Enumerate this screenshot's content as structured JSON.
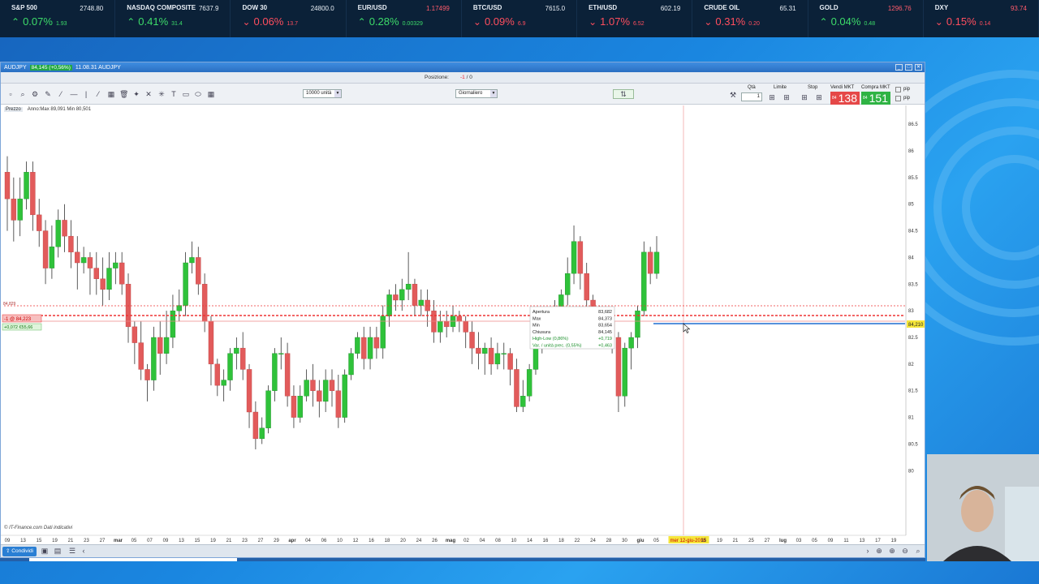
{
  "ticker": [
    {
      "name": "S&P 500",
      "price": "2748.80",
      "direction": "up",
      "pct": "0.07%",
      "change": "1.93"
    },
    {
      "name": "NASDAQ COMPOSITE",
      "price": "7637.9",
      "direction": "up",
      "pct": "0.41%",
      "change": "31.4"
    },
    {
      "name": "DOW 30",
      "price": "24800.0",
      "direction": "down",
      "pct": "0.06%",
      "change": "13.7"
    },
    {
      "name": "EUR/USD",
      "price": "1.17499",
      "price_negative": true,
      "direction": "up",
      "pct": "0.28%",
      "change": "0.00329"
    },
    {
      "name": "BTC/USD",
      "price": "7615.0",
      "direction": "down",
      "pct": "0.09%",
      "change": "6.9"
    },
    {
      "name": "ETH/USD",
      "price": "602.19",
      "direction": "down",
      "pct": "1.07%",
      "change": "6.52"
    },
    {
      "name": "CRUDE OIL",
      "price": "65.31",
      "direction": "down",
      "pct": "0.31%",
      "change": "0.20"
    },
    {
      "name": "GOLD",
      "price": "1296.76",
      "price_negative": true,
      "direction": "up",
      "pct": "0.04%",
      "change": "0.48"
    },
    {
      "name": "DXY",
      "price": "93.74",
      "price_negative": true,
      "direction": "down",
      "pct": "0.15%",
      "change": "0.14"
    }
  ],
  "window": {
    "title": "AUDJPY",
    "badge": "84,145 (+0,56%)",
    "time": "11.08.31 AUDJPY"
  },
  "posbar": {
    "label": "Posizione:",
    "value_red": "-1",
    "value_rest": "/ 0"
  },
  "toolbar": {
    "qty_select": "10000 unità",
    "period_select": "Giornaliero"
  },
  "trade": {
    "qta_label": "Qtà",
    "qta_value": "1",
    "limite_label": "Limite",
    "stop_label": "Stop",
    "sell_label": "Vendi MKT",
    "buy_label": "Compra MKT",
    "sell_small": "84",
    "sell_big": "138",
    "buy_small": "84",
    "buy_big": "151",
    "pip_label": "pip"
  },
  "legend": {
    "prezzo": "Prezzo",
    "range": "Anno:Max 89,091 Min 80,501"
  },
  "tooltip": {
    "rows": [
      {
        "label": "Apertura",
        "value": "83,682"
      },
      {
        "label": "Max",
        "value": "84,373"
      },
      {
        "label": "Min",
        "value": "83,654"
      },
      {
        "label": "Chiusura",
        "value": "84,145"
      },
      {
        "label": "High-Low (0,86%)",
        "value": "+0,719"
      },
      {
        "label": "Var. / unità prec. (0,55%)",
        "value": "+0,463"
      }
    ]
  },
  "position_marker": {
    "label": "-1 @ 84,223",
    "pl": "+0,072",
    "pl_eur": "€55,66",
    "left_value": "84,829"
  },
  "price_tag": "84,210",
  "y_axis": [
    "86.5",
    "86",
    "85.5",
    "85",
    "84.5",
    "84",
    "83.5",
    "83",
    "82.5",
    "82",
    "81.5",
    "81",
    "80.5",
    "80"
  ],
  "x_axis": {
    "days": [
      "09",
      "13",
      "15",
      "19",
      "21",
      "23",
      "27",
      "mar",
      "05",
      "07",
      "09",
      "13",
      "15",
      "19",
      "21",
      "23",
      "27",
      "29",
      "apr",
      "04",
      "06",
      "10",
      "12",
      "16",
      "18",
      "20",
      "24",
      "26",
      "mag",
      "02",
      "04",
      "08",
      "10",
      "14",
      "16",
      "18",
      "22",
      "24",
      "28",
      "30",
      "giu",
      "05",
      "07",
      "mer 12-giu-2018",
      "15",
      "19",
      "21",
      "25",
      "27",
      "lug",
      "03",
      "05",
      "09",
      "11",
      "13",
      "17",
      "19"
    ]
  },
  "footnote": "© IT-Finance.com  Dati indicativi",
  "condividi": "Condividi",
  "colors": {
    "bull": "#2fc23a",
    "bear": "#e25b5b",
    "accent": "#1e6fd0"
  },
  "chart_data": {
    "type": "candlestick",
    "title": "AUDJPY",
    "ylim": [
      79.7,
      86.7
    ],
    "candles": [
      [
        85.6,
        85.1,
        85.9,
        84.5
      ],
      [
        85.1,
        84.7,
        85.5,
        84.3
      ],
      [
        84.7,
        85.1,
        85.5,
        84.4
      ],
      [
        85.1,
        85.6,
        85.8,
        84.9
      ],
      [
        85.6,
        84.8,
        85.8,
        84.5
      ],
      [
        84.8,
        84.5,
        85.1,
        84.2
      ],
      [
        84.5,
        83.8,
        84.7,
        83.5
      ],
      [
        83.8,
        84.2,
        84.6,
        83.6
      ],
      [
        84.2,
        84.7,
        84.9,
        84.0
      ],
      [
        84.7,
        84.4,
        85.0,
        84.1
      ],
      [
        84.4,
        84.1,
        84.7,
        83.8
      ],
      [
        84.1,
        83.9,
        84.4,
        83.4
      ],
      [
        83.9,
        84.0,
        84.2,
        83.7
      ],
      [
        84.0,
        83.8,
        84.1,
        83.3
      ],
      [
        83.8,
        83.6,
        84.1,
        83.3
      ],
      [
        83.6,
        83.4,
        84.0,
        83.1
      ],
      [
        83.4,
        83.8,
        84.1,
        83.2
      ],
      [
        83.8,
        83.9,
        84.1,
        83.5
      ],
      [
        83.9,
        83.5,
        84.1,
        83.3
      ],
      [
        83.5,
        82.7,
        83.7,
        82.4
      ],
      [
        82.7,
        82.4,
        82.8,
        82.0
      ],
      [
        82.4,
        81.9,
        82.8,
        81.7
      ],
      [
        81.9,
        81.7,
        82.0,
        81.3
      ],
      [
        81.7,
        82.5,
        82.7,
        81.5
      ],
      [
        82.5,
        82.2,
        82.8,
        81.8
      ],
      [
        82.2,
        82.5,
        83.0,
        82.0
      ],
      [
        82.5,
        83.0,
        83.3,
        82.3
      ],
      [
        83.0,
        83.1,
        83.4,
        82.8
      ],
      [
        83.1,
        83.9,
        84.1,
        82.9
      ],
      [
        83.9,
        84.0,
        84.3,
        83.7
      ],
      [
        84.0,
        83.5,
        84.2,
        83.3
      ],
      [
        83.5,
        82.8,
        83.7,
        82.6
      ],
      [
        82.8,
        82.0,
        82.9,
        81.6
      ],
      [
        82.0,
        81.6,
        82.1,
        81.4
      ],
      [
        81.6,
        81.7,
        81.9,
        81.3
      ],
      [
        81.7,
        82.2,
        82.3,
        81.5
      ],
      [
        82.2,
        82.3,
        82.5,
        81.9
      ],
      [
        82.3,
        81.9,
        82.6,
        81.7
      ],
      [
        81.9,
        81.1,
        82.0,
        80.8
      ],
      [
        81.1,
        80.6,
        81.3,
        80.4
      ],
      [
        80.6,
        80.8,
        81.0,
        80.5
      ],
      [
        80.8,
        81.5,
        81.6,
        80.7
      ],
      [
        81.5,
        82.2,
        82.3,
        81.3
      ],
      [
        82.2,
        82.2,
        82.5,
        81.9
      ],
      [
        82.2,
        81.4,
        82.4,
        81.2
      ],
      [
        81.4,
        81.0,
        81.6,
        80.8
      ],
      [
        81.0,
        81.4,
        81.6,
        80.9
      ],
      [
        81.4,
        81.7,
        81.9,
        81.3
      ],
      [
        81.7,
        81.5,
        82.0,
        81.2
      ],
      [
        81.5,
        81.3,
        81.7,
        81.0
      ],
      [
        81.3,
        81.7,
        81.9,
        81.1
      ],
      [
        81.7,
        81.5,
        81.9,
        81.2
      ],
      [
        81.5,
        81.0,
        81.8,
        80.8
      ],
      [
        81.0,
        81.8,
        81.9,
        80.9
      ],
      [
        81.8,
        82.2,
        82.3,
        81.7
      ],
      [
        82.2,
        82.5,
        82.6,
        82.1
      ],
      [
        82.5,
        82.1,
        82.7,
        81.9
      ],
      [
        82.1,
        82.5,
        82.7,
        81.9
      ],
      [
        82.5,
        82.3,
        82.7,
        82.1
      ],
      [
        82.3,
        82.9,
        83.1,
        82.1
      ],
      [
        82.9,
        83.3,
        83.4,
        82.7
      ],
      [
        83.3,
        83.2,
        83.5,
        83.0
      ],
      [
        83.2,
        83.4,
        83.6,
        83.0
      ],
      [
        83.4,
        83.5,
        84.1,
        83.2
      ],
      [
        83.5,
        83.1,
        83.6,
        82.9
      ],
      [
        83.1,
        83.2,
        83.4,
        82.9
      ],
      [
        83.2,
        83.0,
        83.4,
        82.7
      ],
      [
        83.0,
        82.6,
        83.2,
        82.4
      ],
      [
        82.6,
        82.8,
        83.0,
        82.4
      ],
      [
        82.8,
        82.7,
        83.0,
        82.5
      ],
      [
        82.7,
        82.9,
        83.1,
        82.6
      ],
      [
        82.9,
        82.8,
        83.0,
        82.6
      ],
      [
        82.8,
        82.6,
        82.9,
        82.3
      ],
      [
        82.6,
        82.3,
        82.8,
        82.0
      ],
      [
        82.3,
        82.2,
        82.6,
        81.9
      ],
      [
        82.2,
        82.3,
        82.4,
        81.8
      ],
      [
        82.3,
        82.0,
        82.5,
        81.8
      ],
      [
        82.0,
        82.2,
        82.4,
        81.9
      ],
      [
        82.2,
        82.2,
        82.4,
        81.9
      ],
      [
        82.2,
        81.9,
        82.3,
        81.6
      ],
      [
        81.9,
        81.2,
        82.1,
        81.1
      ],
      [
        81.2,
        81.4,
        81.7,
        81.1
      ],
      [
        81.4,
        81.9,
        82.0,
        81.3
      ],
      [
        81.9,
        82.4,
        82.6,
        81.8
      ],
      [
        82.4,
        82.5,
        82.7,
        82.2
      ],
      [
        82.5,
        82.6,
        82.9,
        82.3
      ],
      [
        82.6,
        83.0,
        83.2,
        82.4
      ],
      [
        83.0,
        83.3,
        83.4,
        82.8
      ],
      [
        83.3,
        83.7,
        84.0,
        83.1
      ],
      [
        83.7,
        84.3,
        84.6,
        83.5
      ],
      [
        84.3,
        83.7,
        84.4,
        83.4
      ],
      [
        83.7,
        83.2,
        83.9,
        83.0
      ],
      [
        83.2,
        82.9,
        83.3,
        82.5
      ],
      [
        82.9,
        82.7,
        83.1,
        82.4
      ],
      [
        82.7,
        82.8,
        83.0,
        82.5
      ],
      [
        82.8,
        82.5,
        82.9,
        82.2
      ],
      [
        82.5,
        81.4,
        82.6,
        81.1
      ],
      [
        81.4,
        82.3,
        82.4,
        81.2
      ],
      [
        82.3,
        82.5,
        82.6,
        81.9
      ],
      [
        82.5,
        83.0,
        83.1,
        82.3
      ],
      [
        83.0,
        84.1,
        84.3,
        82.9
      ],
      [
        84.1,
        83.7,
        84.2,
        83.5
      ],
      [
        83.7,
        84.1,
        84.4,
        83.6
      ]
    ]
  }
}
